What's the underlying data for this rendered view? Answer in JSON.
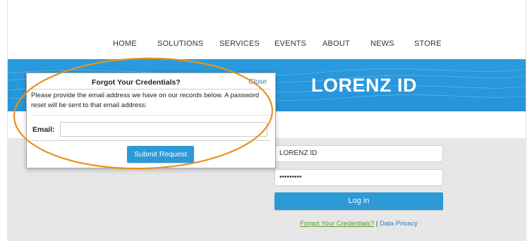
{
  "nav": {
    "items": [
      "HOME",
      "SOLUTIONS",
      "SERVICES",
      "EVENTS",
      "ABOUT",
      "NEWS",
      "STORE"
    ]
  },
  "banner": {
    "title": "LORENZ ID"
  },
  "login": {
    "username_value": "LORENZ ID",
    "password_value": "•••••••••",
    "login_label": "Log in",
    "forgot_link": "Forgot Your Credentials?",
    "separator": " | ",
    "privacy_link": "Data Privacy"
  },
  "modal": {
    "title": "Forgot Your Credentials?",
    "close_label": "Close",
    "message": "Please provide the email address we have on our records below. A password reset will be sent to that email address:",
    "email_label": "Email:",
    "email_value": "",
    "submit_label": "Submit Request"
  },
  "colors": {
    "banner_blue": "#2594d8",
    "button_blue": "#2d9ad8",
    "highlight_orange": "#e8921c",
    "link_green": "#5a9a2a",
    "link_blue": "#2a7fc2"
  }
}
